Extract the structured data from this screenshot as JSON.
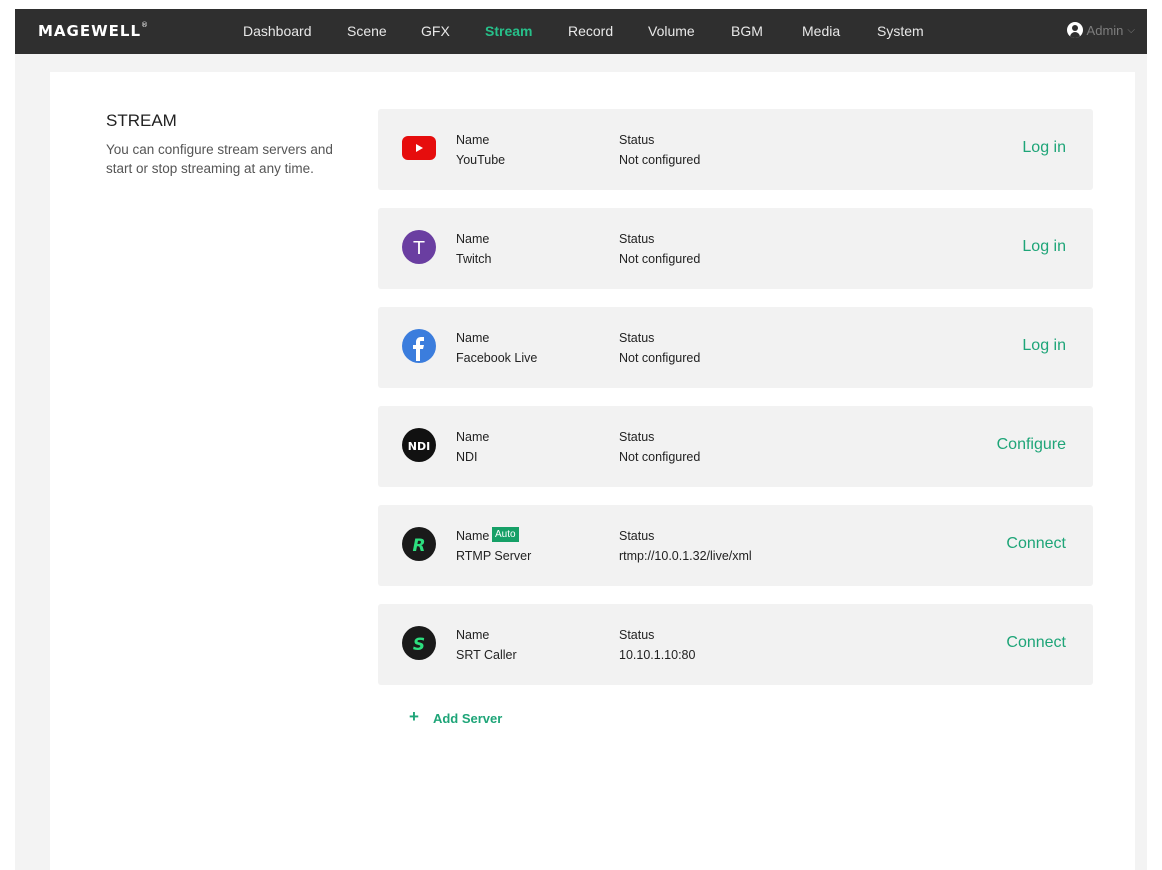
{
  "nav": {
    "logo": "MAGEWELL",
    "logo_mark": "®",
    "items": [
      {
        "label": "Dashboard",
        "active": false
      },
      {
        "label": "Scene",
        "active": false
      },
      {
        "label": "GFX",
        "active": false
      },
      {
        "label": "Stream",
        "active": true
      },
      {
        "label": "Record",
        "active": false
      },
      {
        "label": "Volume",
        "active": false
      },
      {
        "label": "BGM",
        "active": false
      },
      {
        "label": "Media",
        "active": false
      },
      {
        "label": "System",
        "active": false
      }
    ],
    "user": "Admin",
    "user_icon": "user-icon",
    "chevron": "⌵"
  },
  "section": {
    "title": "STREAM",
    "description": "You can configure stream servers and start or stop streaming at any time."
  },
  "servers": [
    {
      "icon": "youtube-icon",
      "name_label": "Name",
      "name": "YouTube",
      "status_label": "Status",
      "status": "Not configured",
      "action": "Log in",
      "badge": ""
    },
    {
      "icon": "twitch-icon",
      "name_label": "Name",
      "name": "Twitch",
      "status_label": "Status",
      "status": "Not configured",
      "action": "Log in",
      "badge": ""
    },
    {
      "icon": "facebook-icon",
      "name_label": "Name",
      "name": "Facebook Live",
      "status_label": "Status",
      "status": "Not configured",
      "action": "Log in",
      "badge": ""
    },
    {
      "icon": "ndi-icon",
      "name_label": "Name",
      "name": "NDI",
      "status_label": "Status",
      "status": "Not configured",
      "action": "Configure",
      "badge": ""
    },
    {
      "icon": "rtmp-icon",
      "name_label": "Name",
      "name": "RTMP Server",
      "status_label": "Status",
      "status": "rtmp://10.0.1.32/live/xml",
      "action": "Connect",
      "badge": "Auto"
    },
    {
      "icon": "srt-icon",
      "name_label": "Name",
      "name": "SRT Caller",
      "status_label": "Status",
      "status": "10.10.1.10:80",
      "action": "Connect",
      "badge": ""
    }
  ],
  "add_server": {
    "icon": "+",
    "label": "Add Server"
  },
  "colors": {
    "accent": "#1ea578",
    "nav_bg": "#2f2f2f",
    "card_bg": "#f2f2f2",
    "youtube": "#e60d0d",
    "twitch": "#6a3ea1",
    "facebook": "#3b7ddd"
  }
}
